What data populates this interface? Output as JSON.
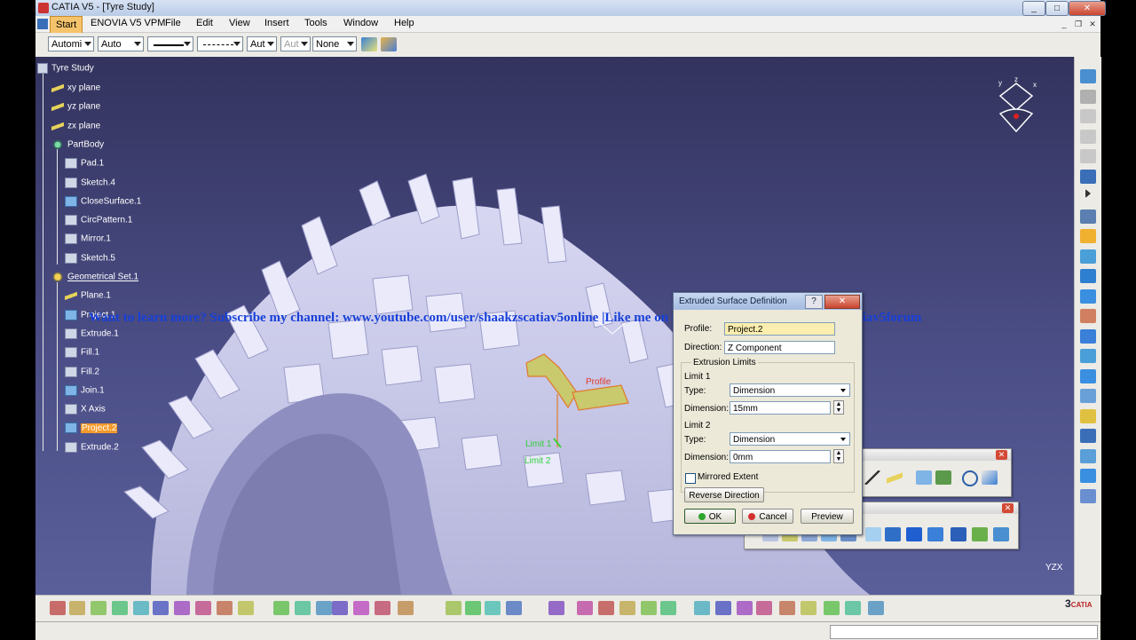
{
  "window": {
    "title": "CATIA V5 - [Tyre Study]"
  },
  "menubar": {
    "start": "Start",
    "items": [
      "ENOVIA V5 VPM",
      "File",
      "Edit",
      "View",
      "Insert",
      "Tools",
      "Window",
      "Help"
    ]
  },
  "propbar": {
    "combo1": "Automi",
    "combo2": "Auto",
    "combo5": "Aut",
    "combo6": "Aut",
    "combo7": "None"
  },
  "tree": {
    "root": "Tyre Study",
    "nodes": [
      {
        "label": "xy plane",
        "icon": "plane-icon"
      },
      {
        "label": "yz plane",
        "icon": "plane-icon"
      },
      {
        "label": "zx plane",
        "icon": "plane-icon"
      },
      {
        "label": "PartBody",
        "icon": "partbody-icon"
      },
      {
        "label": "Pad.1",
        "icon": "pad-icon"
      },
      {
        "label": "Sketch.4",
        "icon": "sketch-icon"
      },
      {
        "label": "CloseSurface.1",
        "icon": "closesurface-icon"
      },
      {
        "label": "CircPattern.1",
        "icon": "circpattern-icon"
      },
      {
        "label": "Mirror.1",
        "icon": "mirror-icon"
      },
      {
        "label": "Sketch.5",
        "icon": "sketch-icon"
      },
      {
        "label": "Geometrical Set.1",
        "icon": "geometrical-set-icon"
      },
      {
        "label": "Plane.1",
        "icon": "plane-icon"
      },
      {
        "label": "Project.1",
        "icon": "project-icon"
      },
      {
        "label": "Extrude.1",
        "icon": "extrude-icon"
      },
      {
        "label": "Fill.1",
        "icon": "fill-icon"
      },
      {
        "label": "Fill.2",
        "icon": "fill-icon"
      },
      {
        "label": "Join.1",
        "icon": "join-icon"
      },
      {
        "label": "X Axis",
        "icon": "axis-icon"
      },
      {
        "label": "Project.2",
        "icon": "project-icon"
      },
      {
        "label": "Extrude.2",
        "icon": "extrude-icon"
      }
    ]
  },
  "banner": "Want to learn more? Subscribe my channel: www.youtube.com/user/shaakzscatiav5online |Like me on fb:www.facebook.com/shaakzscatiav5forum",
  "viewport_labels": {
    "profile": "Profile",
    "limit1": "Limit 1",
    "limit2": "Limit 2"
  },
  "dialog": {
    "title": "Extruded Surface Definition",
    "profile_label": "Profile:",
    "profile_value": "Project.2",
    "direction_label": "Direction:",
    "direction_value": "Z Component",
    "group_label": "Extrusion Limits",
    "limit1_label": "Limit 1",
    "limit1_type_label": "Type:",
    "limit1_type": "Dimension",
    "limit1_dim_label": "Dimension:",
    "limit1_dim": "15mm",
    "limit2_label": "Limit 2",
    "limit2_type_label": "Type:",
    "limit2_type": "Dimension",
    "limit2_dim_label": "Dimension:",
    "limit2_dim": "0mm",
    "mirrored_label": "Mirrored Extent",
    "reverse_label": "Reverse Direction",
    "ok_label": "OK",
    "cancel_label": "Cancel",
    "preview_label": "Preview"
  },
  "floating_toolbar": {
    "title_fragment": "rme"
  },
  "compass": {
    "x": "x",
    "y": "y",
    "z": "z"
  },
  "axis_indicator": "YZX",
  "logo": "CATIA",
  "colors": {
    "viewport_top": "#33335e",
    "viewport_bottom": "#5a5f9a",
    "tyre": "#cfcfee",
    "selection": "#f39a2a",
    "banner": "#1840d8",
    "profile_label": "#e03a2a",
    "limit_label": "#2fcf3a"
  }
}
